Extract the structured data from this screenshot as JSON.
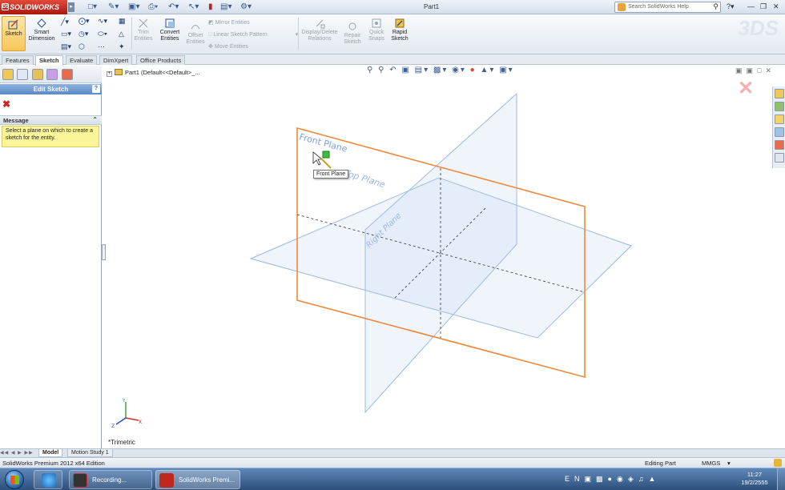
{
  "titlebar": {
    "app_logo": "SOLIDWORKS",
    "window_title": "Part1",
    "search_placeholder": "Search SolidWorks Help",
    "colors": {
      "logo_red": "#c0281c"
    }
  },
  "commandmanager": {
    "sketch": "Sketch",
    "smart_dimension": "Smart Dimension",
    "trim_entities": "Trim Entities",
    "convert_entities": "Convert Entities",
    "offset_entities": "Offset Entities",
    "mirror_entities": "Mirror Entities",
    "linear_sketch_pattern": "Linear Sketch Pattern",
    "move_entities": "Move Entities",
    "display_delete_relations": "Display/Delete Relations",
    "repair_sketch": "Repair Sketch",
    "quick_snaps": "Quick Snaps",
    "rapid_sketch": "Rapid Sketch"
  },
  "tabs": [
    {
      "label": "Features",
      "active": false
    },
    {
      "label": "Sketch",
      "active": true
    },
    {
      "label": "Evaluate",
      "active": false
    },
    {
      "label": "DimXpert",
      "active": false
    },
    {
      "label": "Office Products",
      "active": false
    }
  ],
  "leftpanel": {
    "title": "Edit Sketch",
    "help": "?",
    "message_header": "Message",
    "message_text": "Select a plane on which to create a sketch for the entity."
  },
  "graphics": {
    "tree_root": "Part1  (Default<<Default>_...",
    "planes": {
      "front": "Front Plane",
      "top": "Top Plane",
      "right": "Right Plane"
    },
    "tooltip": "Front Plane",
    "view_name": "*Trimetric",
    "triad": {
      "x": "X",
      "y": "Y",
      "z": "Z"
    },
    "colors": {
      "front_plane": "#f0883a",
      "plane_blue": "#8fb0e0",
      "plane_label": "#7f9fd4"
    }
  },
  "bottom_tabs": [
    {
      "label": "Model",
      "active": true
    },
    {
      "label": "Motion Study 1",
      "active": false
    }
  ],
  "statusbar": {
    "edition": "SolidWorks Premium 2012 x64 Edition",
    "state": "Editing Part",
    "units": "MMGS"
  },
  "taskbar": {
    "apps": [
      {
        "label": "Recording..."
      },
      {
        "label": "SolidWorks Premi..."
      }
    ],
    "time": "11:27",
    "date": "19/2/2555"
  }
}
